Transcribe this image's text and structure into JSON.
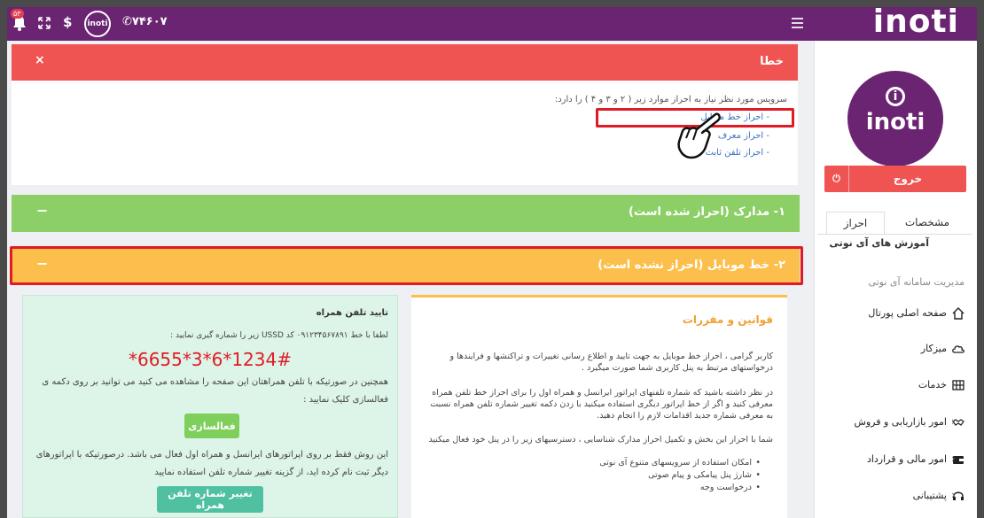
{
  "topbar": {
    "brand": "inoti",
    "badge_count": "۵۳",
    "dollar": "$",
    "logo_text": "inoti",
    "phone": "۷۴۶۰۷"
  },
  "sidebar": {
    "logo_text": "inoti",
    "logout_label": "خروج",
    "tabs": {
      "active": "احراز",
      "other": "مشخصات"
    },
    "subtitle": "آموزش های آی نوتی",
    "section_header": "مدیریت سامانه آی نوتی",
    "items": [
      {
        "label": "صفحه اصلی پورتال",
        "icon": "home-icon"
      },
      {
        "label": "میزکار",
        "icon": "cloud-icon"
      },
      {
        "label": "خدمات",
        "icon": "grid-icon"
      },
      {
        "label": "امور بازاریابی و فروش",
        "icon": "handshake-icon"
      },
      {
        "label": "امور مالی و قرارداد",
        "icon": "wallet-icon"
      },
      {
        "label": "پشتیبانی",
        "icon": "headset-icon"
      }
    ]
  },
  "alert": {
    "title": "خطا",
    "close": "×",
    "message": "سرویس مورد نظر نیاز به احراز موارد زیر ( ۲ و ۳ و ۴ ) را دارد:",
    "links": [
      "- احراز خط موبایل",
      "- احراز معرف",
      "- احراز تلفن ثابت"
    ]
  },
  "panels": {
    "docs": {
      "title": "۱- مدارک (احراز شده است)",
      "toggle": "−"
    },
    "mobile": {
      "title": "۲- خط موبایل (احراز نشده است)",
      "toggle": "−"
    }
  },
  "verify": {
    "title": "تایید تلفن همراه",
    "instruction": "لطفا با خط ۰۹۱۲۳۴۵۶۷۸۹۱ کد USSD زیر را شماره گیری نمایید :",
    "code": "*6655*3*6*1234#",
    "para1": "همچنین در صورتیکه با تلفن همراهتان این صفحه را مشاهده می کنید می توانید بر روی دکمه ی فعالسازی کلیک نمایید :",
    "activate_label": "فعالسازی",
    "para2": "این روش فقط بر روی اپراتورهای ایرانسل و همراه اول فعال می باشد. درصورتیکه با اپراتورهای دیگر ثبت نام کرده اید، از گزینه تغییر شماره تلفن استفاده نمایید",
    "change_label": "تغییر شماره تلفن همراه"
  },
  "rules": {
    "title": "قوانین و مقررات",
    "p1": "کاربر گرامی ، احراز خط موبایل به جهت تایید و اطلاع رسانی تغییرات و تراکنشها و فرایندها و درخواستهای مرتبط به پنل کاربری شما صورت میگیرد .",
    "p2": "در نظر داشته باشید که شماره تلفنهای اپراتور ایرانسل و همراه اول را برای احراز خط تلفن همراه معرفی کنید و اگر از خط اپراتور دیگری استفاده میکنید با زدن دکمه تغییر شماره تلفن همراه نسبت به معرفی شماره جدید اقدامات لازم را انجام دهید.",
    "p3": "شما با احراز این بخش و تکمیل احراز مدارک شناسایی ، دسترسیهای زیر را در پنل خود فعال میکنید",
    "bullets": [
      "امکان استفاده از سرویسهای متنوع آی نوتی",
      "شارژ پنل پیامکی و پیام صوتی",
      "درخواست وجه"
    ]
  }
}
